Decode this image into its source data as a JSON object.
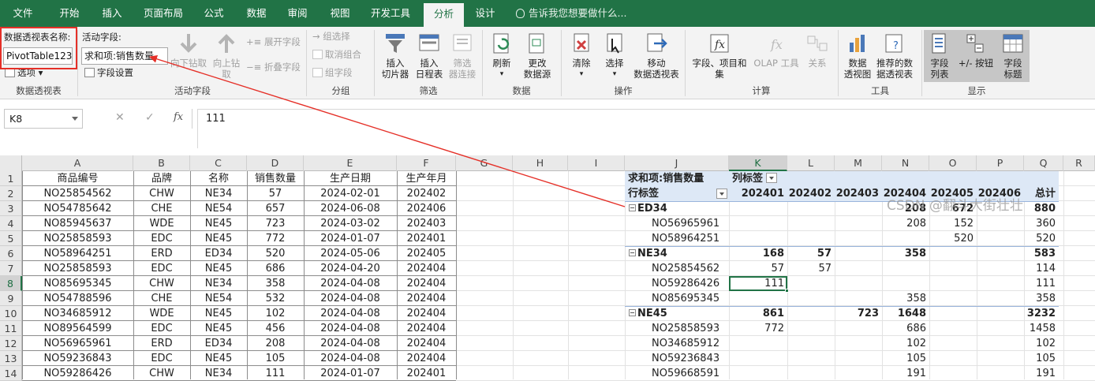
{
  "tabs": [
    "文件",
    "开始",
    "插入",
    "页面布局",
    "公式",
    "数据",
    "审阅",
    "视图",
    "开发工具",
    "分析",
    "设计"
  ],
  "active_tab": "分析",
  "tell_me": "告诉我您想要做什么...",
  "ribbon": {
    "pivot_name_label": "数据透视表名称:",
    "pivot_name_value": "PivotTable123",
    "options_label": "选项",
    "group_pivot": "数据透视表",
    "active_field_label": "活动字段:",
    "active_field_value": "求和项:销售数量",
    "field_settings": "字段设置",
    "drill_down": "向下钻取",
    "drill_up_1": "向上钻",
    "drill_up_2": "取",
    "expand_field": "展开字段",
    "collapse_field": "折叠字段",
    "group_active_field": "活动字段",
    "group_selection": "组选择",
    "ungroup": "取消组合",
    "group_field": "组字段",
    "group_group": "分组",
    "insert_slicer_1": "插入",
    "insert_slicer_2": "切片器",
    "insert_timeline_1": "插入",
    "insert_timeline_2": "日程表",
    "filter_conn_1": "筛选",
    "filter_conn_2": "器连接",
    "group_filter": "筛选",
    "refresh": "刷新",
    "change_source_1": "更改",
    "change_source_2": "数据源",
    "group_data": "数据",
    "clear": "清除",
    "select": "选择",
    "move_pivot_1": "移动",
    "move_pivot_2": "数据透视表",
    "group_actions": "操作",
    "fields_items_1": "字段、项目和",
    "fields_items_2": "集",
    "olap_tools": "OLAP 工具",
    "relationships": "关系",
    "group_calc": "计算",
    "pivot_chart_1": "数据",
    "pivot_chart_2": "透视图",
    "recommended_1": "推荐的数",
    "recommended_2": "据透视表",
    "group_tools": "工具",
    "field_list_1": "字段",
    "field_list_2": "列表",
    "buttons_1": "+/- 按钮",
    "field_headers_1": "字段",
    "field_headers_2": "标题",
    "group_display": "显示"
  },
  "formula_bar": {
    "name_box": "K8",
    "cancel": "✕",
    "enter": "✓",
    "fx": "fx",
    "formula": "111"
  },
  "columns": [
    "A",
    "B",
    "C",
    "D",
    "E",
    "F",
    "G",
    "H",
    "I",
    "J",
    "K",
    "L",
    "M",
    "N",
    "O",
    "P",
    "Q",
    "R"
  ],
  "selected_column": "K",
  "rows": [
    "1",
    "2",
    "3",
    "4",
    "5",
    "6",
    "7",
    "8",
    "9",
    "10",
    "11",
    "12",
    "13",
    "14"
  ],
  "selected_row": "8",
  "source_table": {
    "headers": [
      "商品编号",
      "品牌",
      "名称",
      "销售数量",
      "生产日期",
      "生产年月"
    ],
    "rows": [
      [
        "NO25854562",
        "CHW",
        "NE34",
        "57",
        "2024-02-01",
        "202402"
      ],
      [
        "NO54785642",
        "CHE",
        "NE54",
        "657",
        "2024-06-08",
        "202406"
      ],
      [
        "NO85945637",
        "WDE",
        "NE45",
        "723",
        "2024-03-02",
        "202403"
      ],
      [
        "NO25858593",
        "EDC",
        "NE45",
        "772",
        "2024-01-07",
        "202401"
      ],
      [
        "NO58964251",
        "ERD",
        "ED34",
        "520",
        "2024-05-06",
        "202405"
      ],
      [
        "NO25858593",
        "EDC",
        "NE45",
        "686",
        "2024-04-20",
        "202404"
      ],
      [
        "NO85695345",
        "CHW",
        "NE34",
        "358",
        "2024-04-08",
        "202404"
      ],
      [
        "NO54788596",
        "CHE",
        "NE54",
        "532",
        "2024-04-08",
        "202404"
      ],
      [
        "NO34685912",
        "WDE",
        "NE45",
        "102",
        "2024-04-08",
        "202404"
      ],
      [
        "NO89564599",
        "EDC",
        "NE45",
        "456",
        "2024-04-08",
        "202404"
      ],
      [
        "NO56965961",
        "ERD",
        "ED34",
        "208",
        "2024-04-08",
        "202404"
      ],
      [
        "NO59236843",
        "EDC",
        "NE45",
        "105",
        "2024-04-08",
        "202404"
      ],
      [
        "NO59286426",
        "CHW",
        "NE34",
        "111",
        "2024-01-07",
        "202401"
      ]
    ]
  },
  "pivot": {
    "value_label": "求和项:销售数量",
    "col_label": "列标签",
    "row_label": "行标签",
    "col_headers": [
      "202401",
      "202402",
      "202403",
      "202404",
      "202405",
      "202406",
      "总计"
    ],
    "rows": [
      {
        "label": "ED34",
        "group": true,
        "vals": [
          "",
          "",
          "",
          "208",
          "672",
          "",
          "880"
        ]
      },
      {
        "label": "NO56965961",
        "group": false,
        "vals": [
          "",
          "",
          "",
          "208",
          "152",
          "",
          "360"
        ]
      },
      {
        "label": "NO58964251",
        "group": false,
        "vals": [
          "",
          "",
          "",
          "",
          "520",
          "",
          "520"
        ]
      },
      {
        "label": "NE34",
        "group": true,
        "vals": [
          "168",
          "57",
          "",
          "358",
          "",
          "",
          "583"
        ]
      },
      {
        "label": "NO25854562",
        "group": false,
        "vals": [
          "57",
          "57",
          "",
          "",
          "",
          "",
          "114"
        ]
      },
      {
        "label": "NO59286426",
        "group": false,
        "vals": [
          "111",
          "",
          "",
          "",
          "",
          "",
          "111"
        ]
      },
      {
        "label": "NO85695345",
        "group": false,
        "vals": [
          "",
          "",
          "",
          "358",
          "",
          "",
          "358"
        ]
      },
      {
        "label": "NE45",
        "group": true,
        "vals": [
          "861",
          "",
          "723",
          "1648",
          "",
          "",
          "3232"
        ]
      },
      {
        "label": "NO25858593",
        "group": false,
        "vals": [
          "772",
          "",
          "",
          "686",
          "",
          "",
          "1458"
        ]
      },
      {
        "label": "NO34685912",
        "group": false,
        "vals": [
          "",
          "",
          "",
          "102",
          "",
          "",
          "102"
        ]
      },
      {
        "label": "NO59236843",
        "group": false,
        "vals": [
          "",
          "",
          "",
          "105",
          "",
          "",
          "105"
        ]
      },
      {
        "label": "NO59668591",
        "group": false,
        "vals": [
          "",
          "",
          "",
          "191",
          "",
          "",
          "191"
        ]
      }
    ]
  },
  "watermark": "CSDN @翻斗大街壮壮",
  "colors": {
    "excel_green": "#217346",
    "annotation_red": "#e53028",
    "pivot_header": "#dde8f6"
  }
}
